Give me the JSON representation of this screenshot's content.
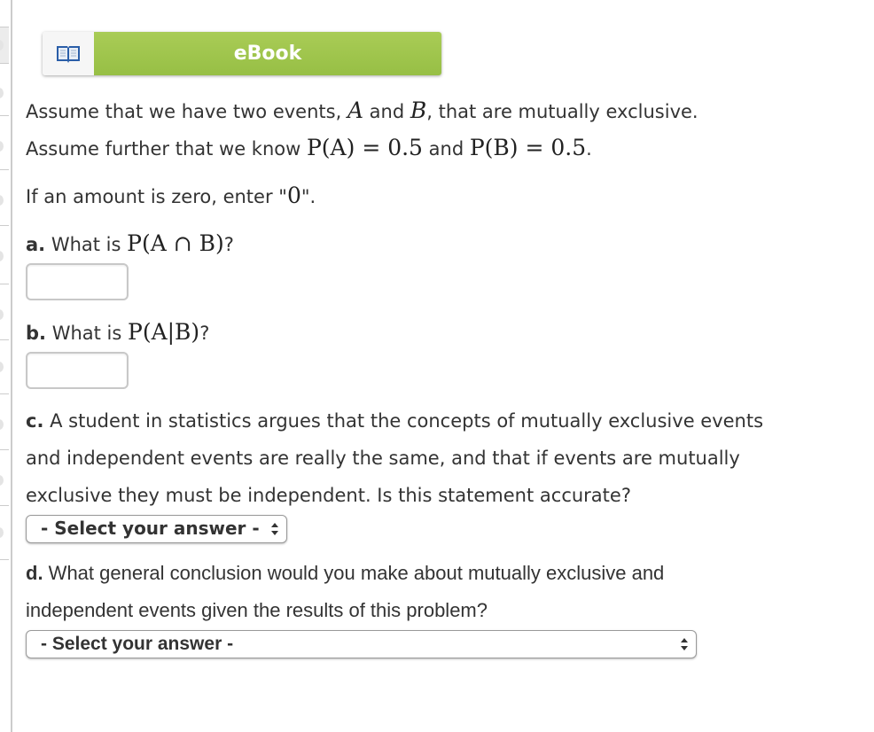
{
  "ebook": {
    "label": "eBook",
    "icon": "open-book-icon"
  },
  "intro": {
    "line1_prefix": "Assume that we have two events, ",
    "event_a": "A",
    "and": " and ",
    "event_b": "B",
    "line1_suffix": ", that are mutually exclusive.",
    "line2_prefix": "Assume further that we know ",
    "pa_expr": "P(A) = 0.5",
    "pb_expr": "P(B) = 0.5",
    "line2_suffix": "."
  },
  "instruction": {
    "text_prefix": "If an amount is zero, enter \"",
    "zero": "0",
    "text_suffix": "\"."
  },
  "questions": {
    "a": {
      "marker": "a.",
      "text": " What is ",
      "expr": "P(A ∩ B)",
      "suffix": "?",
      "value": ""
    },
    "b": {
      "marker": "b.",
      "text": " What is ",
      "expr": "P(A|B)",
      "suffix": "?",
      "value": ""
    },
    "c": {
      "marker": "c.",
      "lines": [
        " A student in statistics argues that the concepts of mutually exclusive events",
        "and independent events are really the same, and that if events are mutually",
        "exclusive they must be independent. Is this statement accurate?"
      ],
      "select": "- Select your answer -"
    },
    "d": {
      "marker": "d.",
      "lines": [
        " What general conclusion would you make about mutually exclusive and",
        "independent events given the results of this problem?"
      ],
      "select": "- Select your answer -"
    }
  }
}
